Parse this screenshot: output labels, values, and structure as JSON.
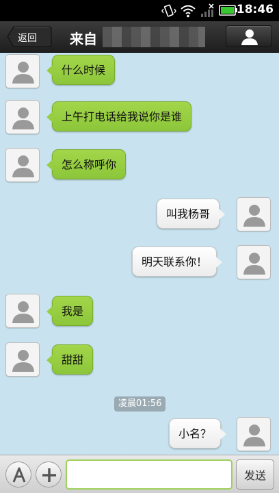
{
  "status_bar": {
    "time": "18:46",
    "icons": [
      "vibrate-icon",
      "wifi-icon",
      "signal-icon",
      "battery-icon"
    ]
  },
  "header": {
    "back_label": "返回",
    "title": "来自",
    "profile_icon": "person-icon"
  },
  "messages": [
    {
      "side": "in",
      "text": "什么时候"
    },
    {
      "side": "in",
      "text": "上午打电话给我说你是谁"
    },
    {
      "side": "in",
      "text": "怎么称呼你"
    },
    {
      "side": "out",
      "text": "叫我杨哥"
    },
    {
      "side": "out",
      "text": "明天联系你！"
    },
    {
      "side": "in",
      "text": "我是"
    },
    {
      "side": "in",
      "text": "甜甜"
    },
    {
      "side": "out",
      "text": "小名？"
    }
  ],
  "timestamp": "凌晨01:56",
  "input_bar": {
    "keyboard_icon": "font-a-icon",
    "add_icon": "plus-icon",
    "message_value": "",
    "send_label": "发送"
  },
  "colors": {
    "incoming_bubble": "#97cd41",
    "outgoing_bubble": "#ffffff",
    "chat_background": "#c8e3ef",
    "header": "#2a2a2a"
  }
}
